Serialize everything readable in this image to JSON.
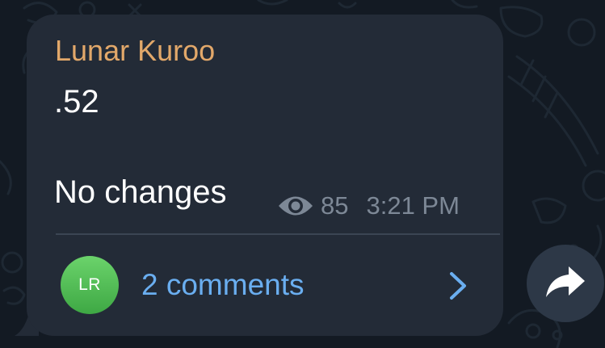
{
  "message": {
    "sender": "Lunar Kuroo",
    "lines": [
      ".52",
      "No changes"
    ],
    "views": "85",
    "time": "3:21 PM",
    "eye_icon": "eye-icon"
  },
  "comments": {
    "avatar_initials": "LR",
    "label": "2 comments",
    "chevron_icon": "chevron-right-icon"
  },
  "forward": {
    "icon": "forward-arrow-icon"
  },
  "colors": {
    "background": "#131a23",
    "bubble": "#232b37",
    "sender": "#e2a86a",
    "text": "#ffffff",
    "meta": "#7d8896",
    "link": "#6aaef0",
    "avatar": "#4cb84f",
    "forward_button": "#2d3847"
  }
}
